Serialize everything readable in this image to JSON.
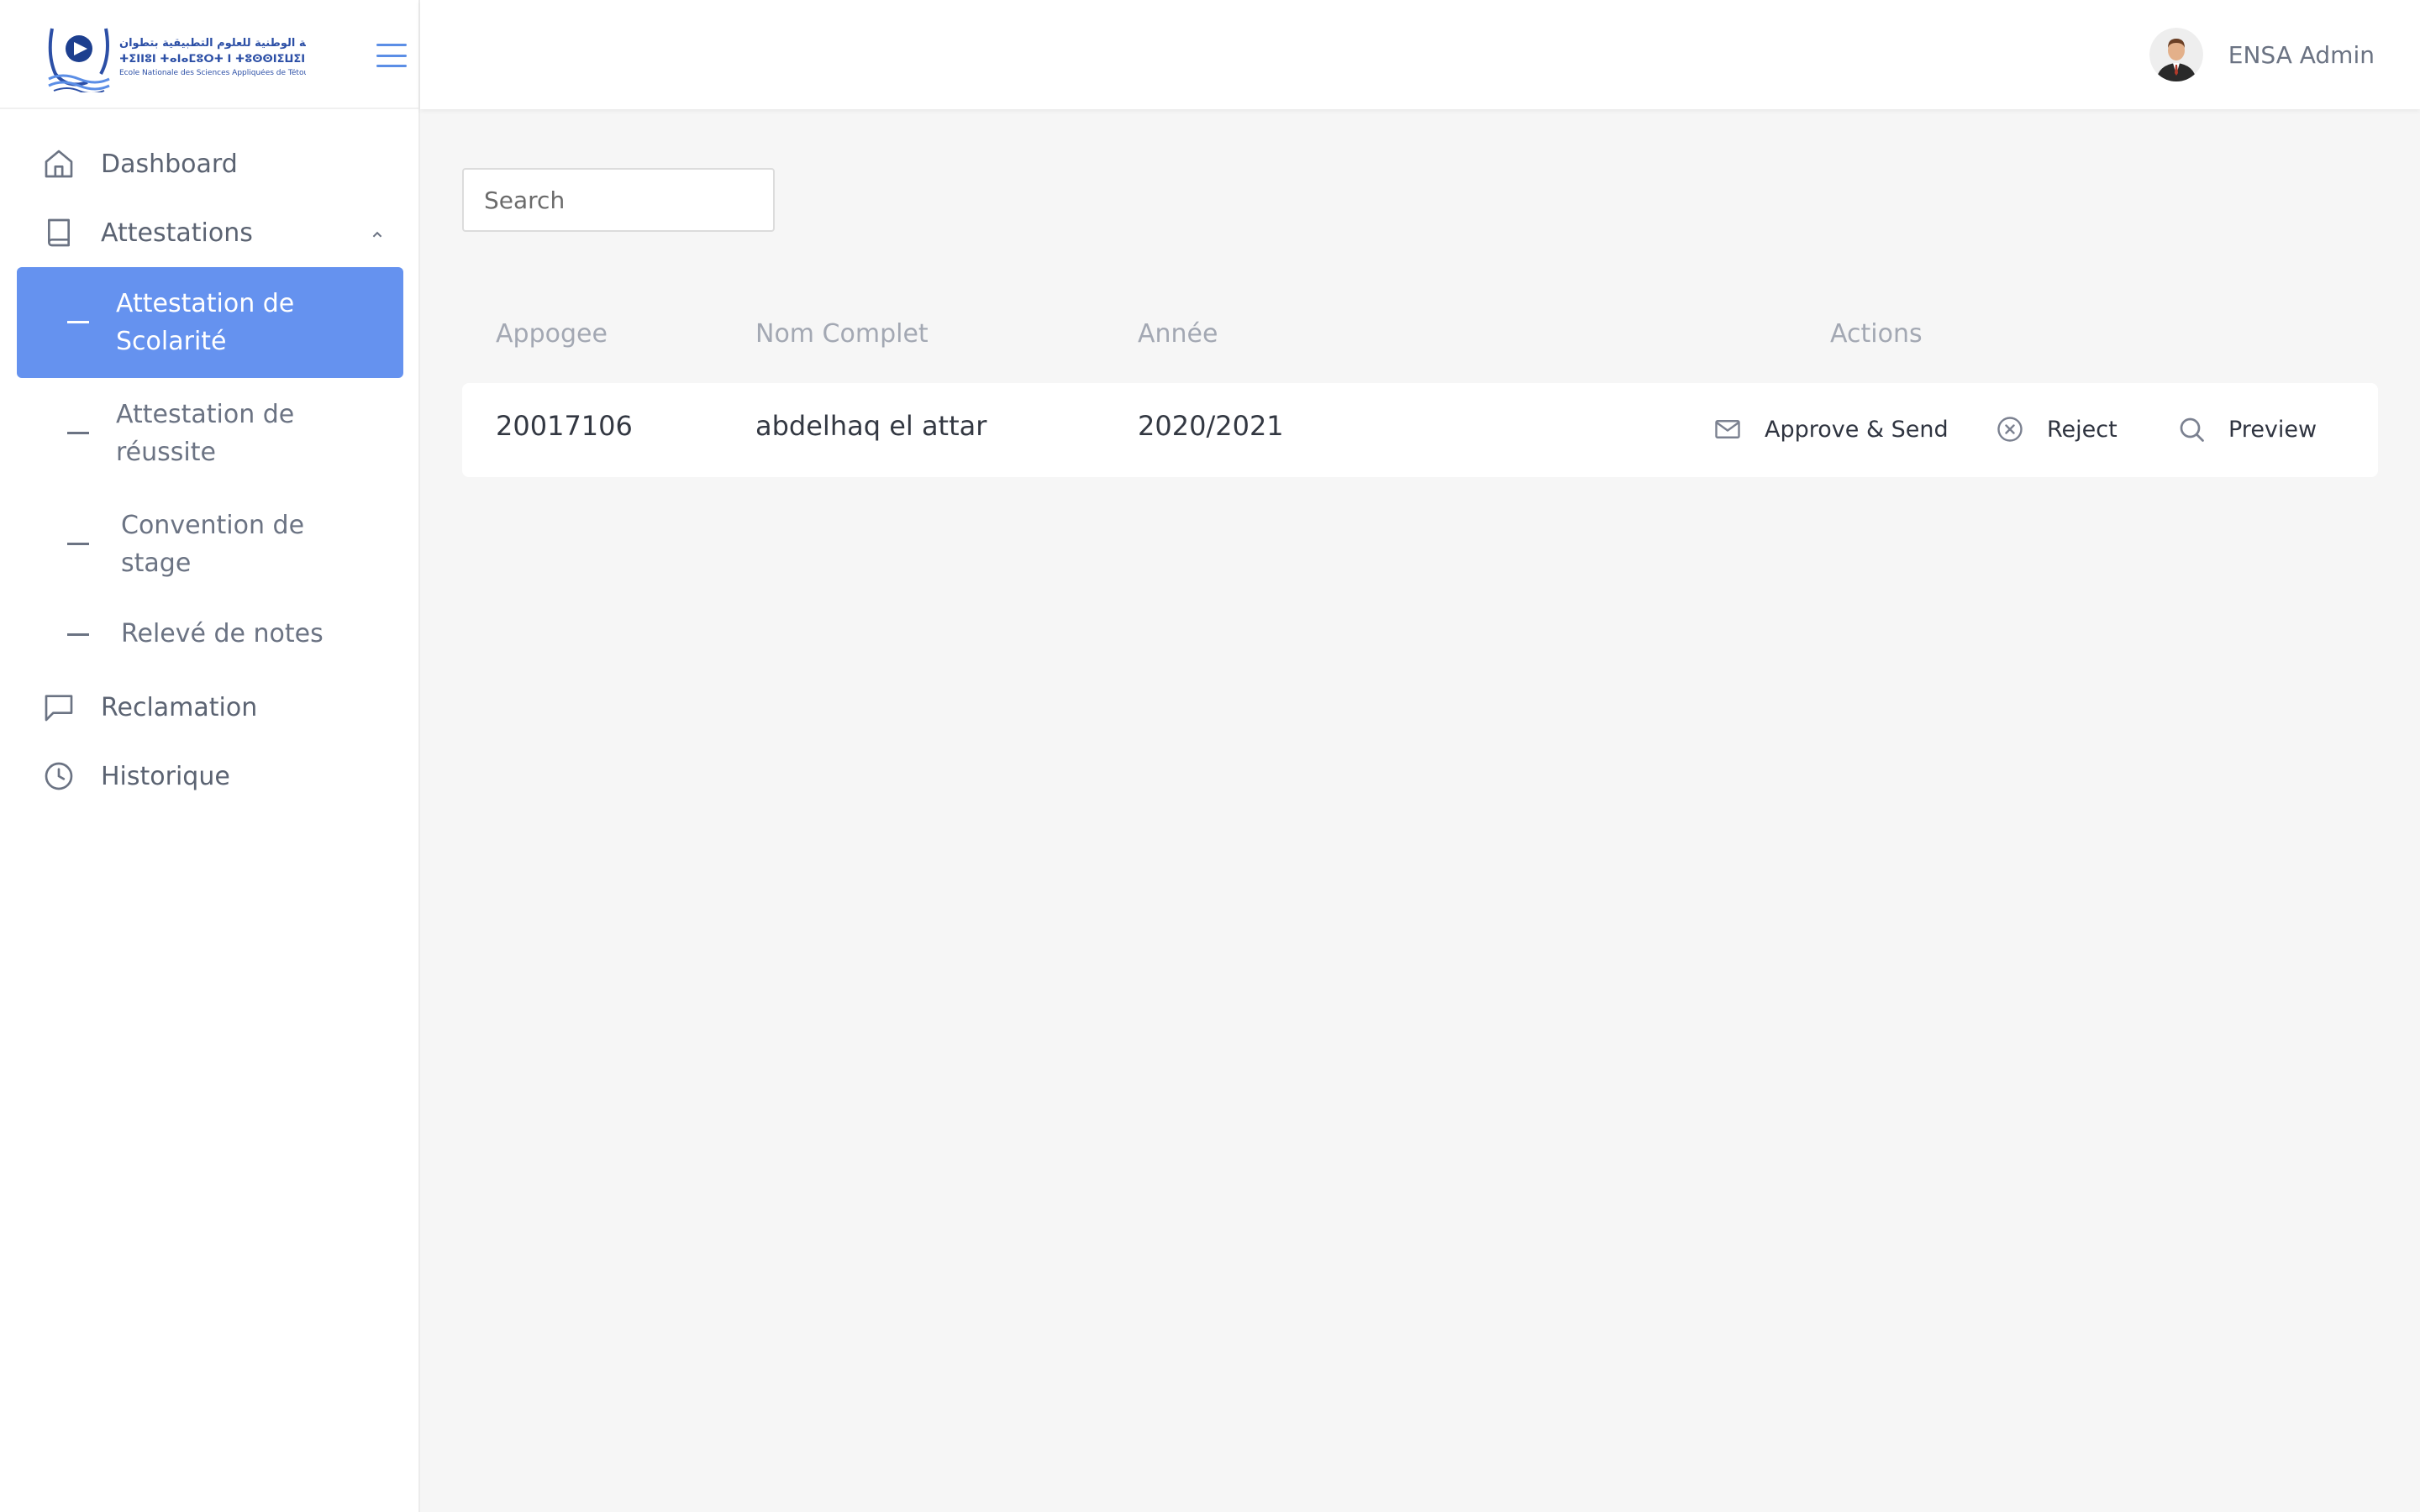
{
  "brand": {
    "logo_line_arabic": "المدرسة الوطنية للعلوم التطبيقية بتطوان",
    "logo_line_tifinagh": "ⵜⵉⵏⵏⵓⵏ ⵜⴰⵏⴰⵎⵓⵔⵜ ⵏ ⵜⵓⵙⵙⵏⵉⵡⵉⵏ ⵜⵉⵡⵙⵙⴰⵏ",
    "logo_line_french": "Ecole Nationale des Sciences Appliquées de Tétouan",
    "accent": "#6592ef"
  },
  "sidebar": {
    "items": [
      {
        "label": "Dashboard",
        "icon": "home-icon"
      },
      {
        "label": "Attestations",
        "icon": "book-icon"
      },
      {
        "label": "Reclamation",
        "icon": "chat-icon"
      },
      {
        "label": "Historique",
        "icon": "clock-icon"
      }
    ],
    "submenu": [
      {
        "label": "Attestation de Scolarité",
        "active": true
      },
      {
        "label": "Attestation de réussite",
        "active": false
      },
      {
        "label": "Convention de stage",
        "active": false
      },
      {
        "label": "Relevé de notes",
        "active": false
      }
    ]
  },
  "header": {
    "user_name": "ENSA Admin"
  },
  "search": {
    "placeholder": "Search",
    "value": ""
  },
  "table": {
    "columns": [
      "Appogee",
      "Nom Complet",
      "Année",
      "Actions"
    ],
    "rows": [
      {
        "appogee": "20017106",
        "nom": "abdelhaq el attar",
        "annee": "2020/2021"
      }
    ],
    "actions": [
      {
        "label": "Approve & Send",
        "icon": "mail-icon"
      },
      {
        "label": "Reject",
        "icon": "x-circle-icon"
      },
      {
        "label": "Preview",
        "icon": "search-icon"
      }
    ]
  }
}
